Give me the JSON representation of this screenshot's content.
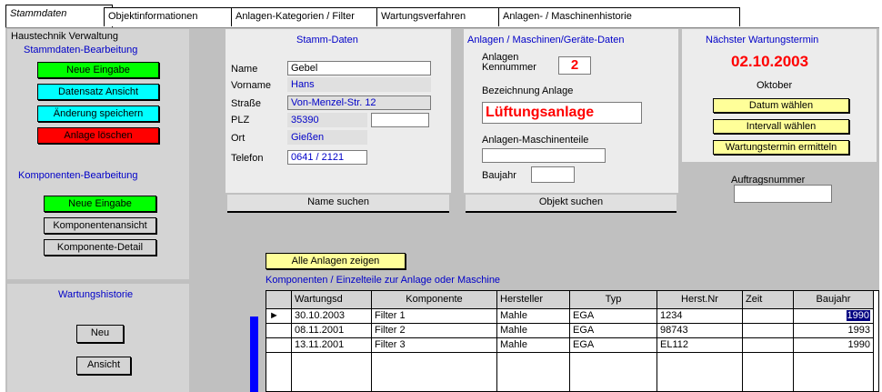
{
  "tabs": [
    {
      "label": "Stammdaten"
    },
    {
      "label": "Objektinformationen"
    },
    {
      "label": "Anlagen-Kategorien / Filter"
    },
    {
      "label": "Wartungsverfahren"
    },
    {
      "label": "Anlagen- / Maschinenhistorie"
    }
  ],
  "left": {
    "section1_title": "Haustechnik Verwaltung",
    "section2_title": "Stammdaten-Bearbeitung",
    "btn_new": "Neue Eingabe",
    "btn_view": "Datensatz Ansicht",
    "btn_save": "Änderung speichern",
    "btn_delete": "Anlage löschen",
    "section3_title": "Komponenten-Bearbeitung",
    "btn_comp_new": "Neue Eingabe",
    "btn_comp_view": "Komponentenansicht",
    "btn_comp_detail": "Komponente-Detail",
    "section4_title": "Wartungshistorie",
    "btn_hist_new": "Neu",
    "btn_hist_view": "Ansicht"
  },
  "stamm": {
    "title": "Stamm-Daten",
    "lbl_name": "Name",
    "val_name": "Gebel",
    "lbl_vorname": "Vorname",
    "val_vorname": "Hans",
    "lbl_strasse": "Straße",
    "val_strasse": "Von-Menzel-Str. 12",
    "lbl_plz": "PLZ",
    "val_plz": "35390",
    "val_ort_extra": "Gießen",
    "lbl_ort": "Ort",
    "val_ort": "Gießen",
    "lbl_telefon": "Telefon",
    "val_telefon": "0641 / 2121",
    "btn_search": "Name suchen"
  },
  "anlagen": {
    "title": "Anlagen / Maschinen/Geräte-Daten",
    "lbl_nr": "Anlagen Kennummer",
    "val_nr": "2",
    "lbl_bez": "Bezeichnung Anlage",
    "val_bez": "Lüftungsanlage",
    "lbl_masch": "Anlagen-Maschinenteile",
    "val_masch": "",
    "lbl_baujahr": "Baujahr",
    "val_baujahr": "",
    "btn_search": "Objekt suchen"
  },
  "wartung": {
    "title": "Nächster Wartungstermin",
    "date": "02.10.2003",
    "month": "Oktober",
    "btn_date": "Datum wählen",
    "btn_term": "Intervall wählen",
    "btn_calc": "Wartungstermin ermitteln",
    "lbl_auftrag": "Auftragsnummer",
    "val_auftrag": ""
  },
  "main": {
    "btn_all": "Alle Anlagen zeigen",
    "list_title": "Komponenten / Einzelteile zur Anlage oder Maschine"
  },
  "grid": {
    "columns": [
      "Wartungsd",
      "Komponente",
      "Hersteller",
      "Typ",
      "Herst.Nr",
      "Zeit",
      "Baujahr"
    ],
    "rows": [
      {
        "marker": "►",
        "cells": [
          "30.10.2003",
          "Filter 1",
          "Mahle",
          "EGA",
          "1234",
          "",
          "1990"
        ]
      },
      {
        "marker": "",
        "cells": [
          "08.11.2001",
          "Filter 2",
          "Mahle",
          "EGA",
          "98743",
          "",
          "1993"
        ]
      },
      {
        "marker": "",
        "cells": [
          "13.11.2001",
          "Filter 3",
          "Mahle",
          "EGA",
          "EL112",
          "",
          "1990"
        ]
      }
    ]
  }
}
